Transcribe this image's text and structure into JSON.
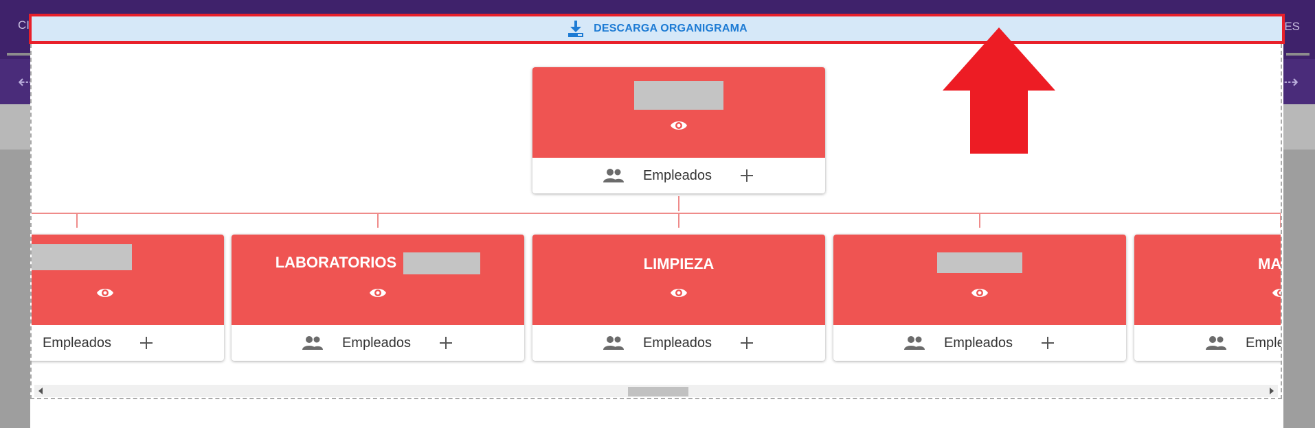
{
  "background": {
    "tab_left_text": "CI",
    "tab_right_text": "IES",
    "back_arrow_icon": "arrow-left-icon",
    "forward_arrow_icon": "arrow-right-icon"
  },
  "download_bar": {
    "label": "DESCARGA ORGANIGRAMA",
    "icon": "download-icon"
  },
  "org_chart": {
    "root": {
      "title": "",
      "title_redacted": true,
      "footer_label": "Empleados"
    },
    "children": [
      {
        "title": "",
        "title_redacted": true,
        "footer_label": "Empleados"
      },
      {
        "title": "LABORATORIOS",
        "title_redacted": true,
        "footer_label": "Empleados"
      },
      {
        "title": "LIMPIEZA",
        "title_redacted": false,
        "footer_label": "Empleados"
      },
      {
        "title": "",
        "title_redacted": true,
        "footer_label": "Empleados"
      },
      {
        "title": "MA",
        "title_redacted": false,
        "footer_label": "Emple"
      }
    ],
    "icons": {
      "view": "eye-icon",
      "people": "people-icon",
      "add": "plus-icon"
    }
  },
  "colors": {
    "card_head": "#ef5452",
    "connector": "#ef8b8a",
    "download_text": "#1d7bd4",
    "download_bg": "#d6e8f8",
    "highlight": "#e8202a"
  }
}
